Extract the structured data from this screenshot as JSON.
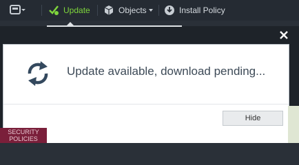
{
  "toolbar": {
    "update_label": "Update",
    "objects_label": "Objects",
    "install_policy_label": "Install Policy"
  },
  "dialog": {
    "message": "Update available, download pending...",
    "hide_label": "Hide"
  },
  "background": {
    "left_nav_label": "SECURITY POLICIES"
  },
  "colors": {
    "toolbar_bg": "#252b33",
    "update_accent": "#7fd63c",
    "dialog_text": "#3d4a57",
    "left_nav_bg": "#7a1f3a"
  }
}
